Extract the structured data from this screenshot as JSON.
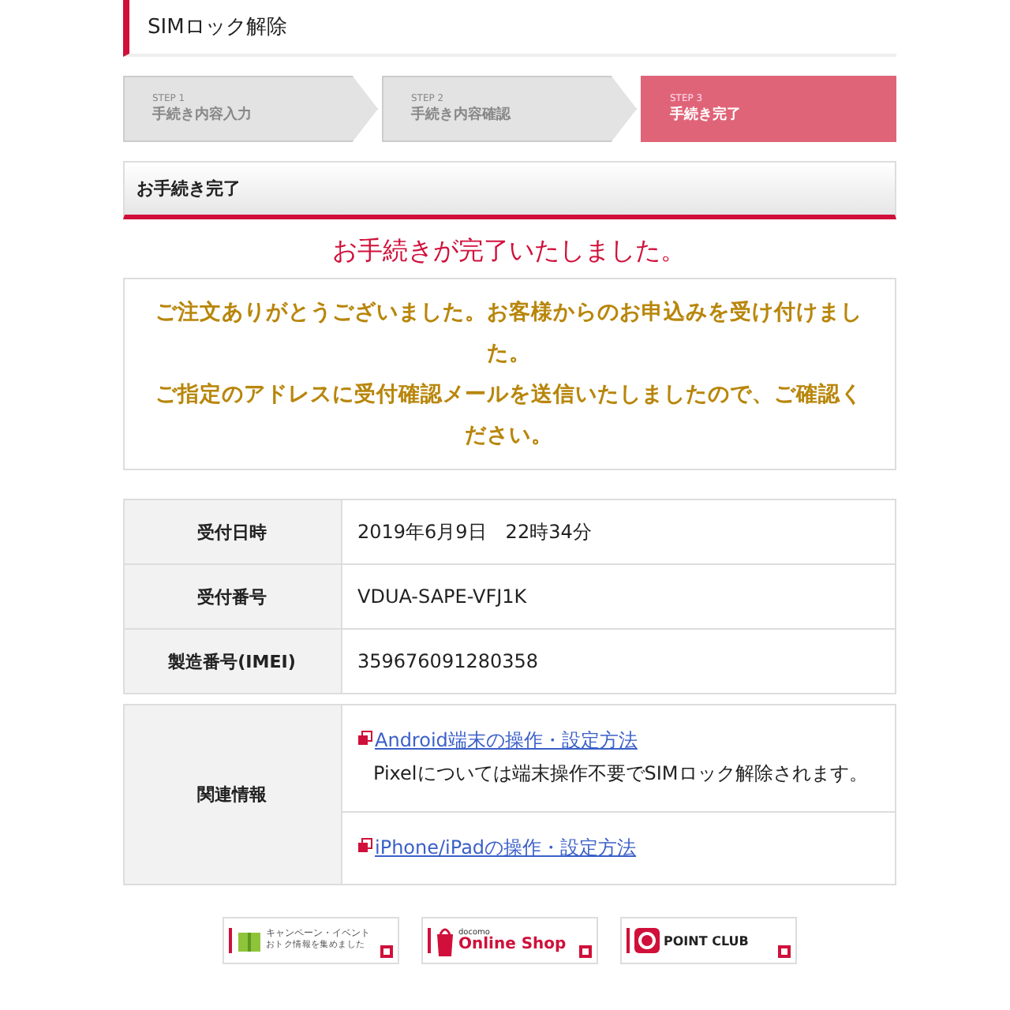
{
  "page_title": "SIMロック解除",
  "steps": [
    {
      "step": "STEP 1",
      "label": "手続き内容入力",
      "selected": false
    },
    {
      "step": "STEP 2",
      "label": "手続き内容確認",
      "selected": false
    },
    {
      "step": "STEP 3",
      "label": "手続き完了",
      "selected": true
    }
  ],
  "section_title": "お手続き完了",
  "complete_heading": "お手続きが完了いたしました。",
  "notice": [
    "ご注文ありがとうございました。お客様からのお申込みを受け付けました。",
    "ご指定のアドレスに受付確認メールを送信いたしましたので、ご確認ください。"
  ],
  "details": [
    {
      "label": "受付日時",
      "value": "2019年6月9日　22時34分"
    },
    {
      "label": "受付番号",
      "value": "VDUA-SAPE-VFJ1K"
    },
    {
      "label": "製造番号(IMEI)",
      "value": "359676091280358"
    }
  ],
  "related": {
    "label": "関連情報",
    "links": [
      {
        "text": "Android端末の操作・設定方法",
        "note": "Pixelについては端末操作不要でSIMロック解除されます。"
      },
      {
        "text": "iPhone/iPadの操作・設定方法"
      }
    ]
  },
  "banners": [
    {
      "kind": "campaign",
      "line1": "キャンペーン・イベント",
      "line2": "おトク情報を集めました"
    },
    {
      "kind": "shop",
      "line1": "docomo",
      "line2": "Online Shop"
    },
    {
      "kind": "point",
      "line1": "POINT CLUB"
    }
  ]
}
